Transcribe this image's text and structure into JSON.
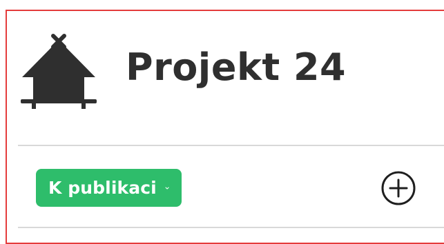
{
  "header": {
    "title": "Projekt 24",
    "icon": "hut-icon"
  },
  "status": {
    "label": "K publikaci",
    "color": "#2ebd6b",
    "icon": "chevron-down-icon"
  },
  "actions": {
    "add_icon": "plus-circle-icon"
  },
  "colors": {
    "frame_border": "#e43b3b",
    "text": "#2f2f2f",
    "divider": "#d8d8d8"
  }
}
